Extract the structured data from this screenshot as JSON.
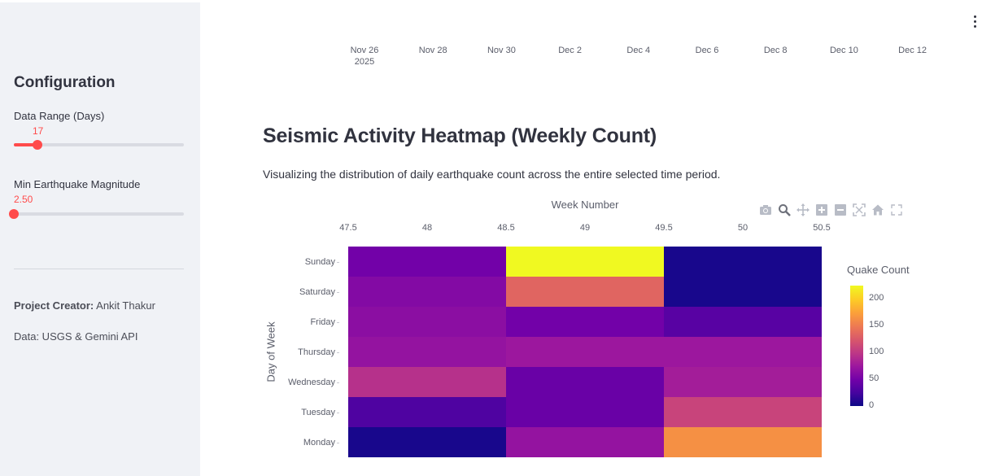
{
  "sidebar": {
    "title": "Configuration",
    "range_label": "Data Range (Days)",
    "range_value": "17",
    "range_fraction": 0.14,
    "magnitude_label": "Min Earthquake Magnitude",
    "magnitude_value": "2.50",
    "magnitude_fraction": 0.0,
    "creator_label": "Project Creator:",
    "creator_name": "Ankit Thakur",
    "data_source": "Data: USGS & Gemini API"
  },
  "timeline": {
    "ticks": [
      "Nov 26",
      "Nov 28",
      "Nov 30",
      "Dec 2",
      "Dec 4",
      "Dec 6",
      "Dec 8",
      "Dec 10",
      "Dec 12"
    ],
    "year": "2025"
  },
  "heading": "Seismic Activity Heatmap (Weekly Count)",
  "description": "Visualizing the distribution of daily earthquake count across the entire selected time period.",
  "modebar": [
    "camera-icon",
    "zoom-icon",
    "pan-icon",
    "zoom-in-icon",
    "zoom-out-icon",
    "autoscale-icon",
    "reset-axes-icon",
    "fullscreen-icon"
  ],
  "chart_data": {
    "type": "heatmap",
    "title": "",
    "xlabel": "Week Number",
    "ylabel": "Day of Week",
    "x_ticks": [
      "47.5",
      "48",
      "48.5",
      "49",
      "49.5",
      "50",
      "50.5"
    ],
    "xlim": [
      47.5,
      50.5
    ],
    "x": [
      48,
      49,
      50
    ],
    "y": [
      "Monday",
      "Tuesday",
      "Wednesday",
      "Thursday",
      "Friday",
      "Saturday",
      "Sunday"
    ],
    "z": [
      [
        5,
        70,
        165
      ],
      [
        30,
        45,
        110
      ],
      [
        95,
        45,
        80
      ],
      [
        70,
        75,
        75
      ],
      [
        65,
        50,
        35
      ],
      [
        60,
        135,
        5
      ],
      [
        50,
        225,
        5
      ]
    ],
    "colorscale": "Plasma",
    "colorbar": {
      "title": "Quake Count",
      "ticks": [
        "0",
        "50",
        "100",
        "150",
        "200"
      ],
      "range": [
        0,
        225
      ]
    }
  }
}
